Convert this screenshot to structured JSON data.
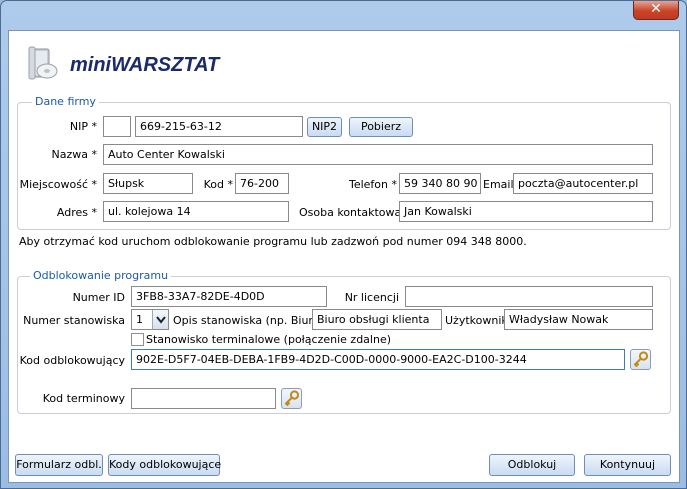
{
  "window": {
    "close_glyph": "✕"
  },
  "app": {
    "title": "miniWARSZTAT"
  },
  "company": {
    "group_title": "Dane firmy",
    "nip_label": "NIP *",
    "nip_prefix": "",
    "nip_value": "669-215-63-12",
    "nip2_button": "NIP2",
    "fetch_button": "Pobierz",
    "name_label": "Nazwa *",
    "name_value": "Auto Center Kowalski",
    "city_label": "Miejscowość *",
    "city_value": "Słupsk",
    "postcode_label": "Kod *",
    "postcode_value": "76-200",
    "phone_label": "Telefon *",
    "phone_value": "59 340 80 90",
    "email_label": "Email",
    "email_value": "poczta@autocenter.pl",
    "address_label": "Adres *",
    "address_value": "ul. kolejowa 14",
    "contact_label": "Osoba kontaktowa",
    "contact_value": "Jan Kowalski"
  },
  "info_text": "Aby otrzymać kod uruchom odblokowanie programu lub zadzwoń pod numer 094 348 8000.",
  "unlock": {
    "group_title": "Odblokowanie programu",
    "id_label": "Numer ID",
    "id_value": "3FB8-33A7-82DE-4D0D",
    "license_label": "Nr licencji",
    "license_value": "",
    "station_label": "Numer stanowiska",
    "station_value": "1",
    "station_desc_label": "Opis stanowiska (np. Biuro)",
    "station_desc_value": "Biuro obsługi klienta",
    "user_label": "Użytkownik",
    "user_value": "Władysław Nowak",
    "terminal_checkbox_label": "Stanowisko terminalowe (połączenie zdalne)",
    "terminal_checked": false,
    "unlock_code_label": "Kod odblokowujący",
    "unlock_code_value": "902E-D5F7-04EB-DEBA-1FB9-4D2D-C00D-0000-9000-EA2C-D100-3244",
    "terminal_code_label": "Kod terminowy",
    "terminal_code_value": ""
  },
  "footer": {
    "form_button": "Formularz odbl.",
    "codes_button": "Kody odblokowujące",
    "unlock_button": "Odblokuj",
    "continue_button": "Kontynuuj"
  }
}
